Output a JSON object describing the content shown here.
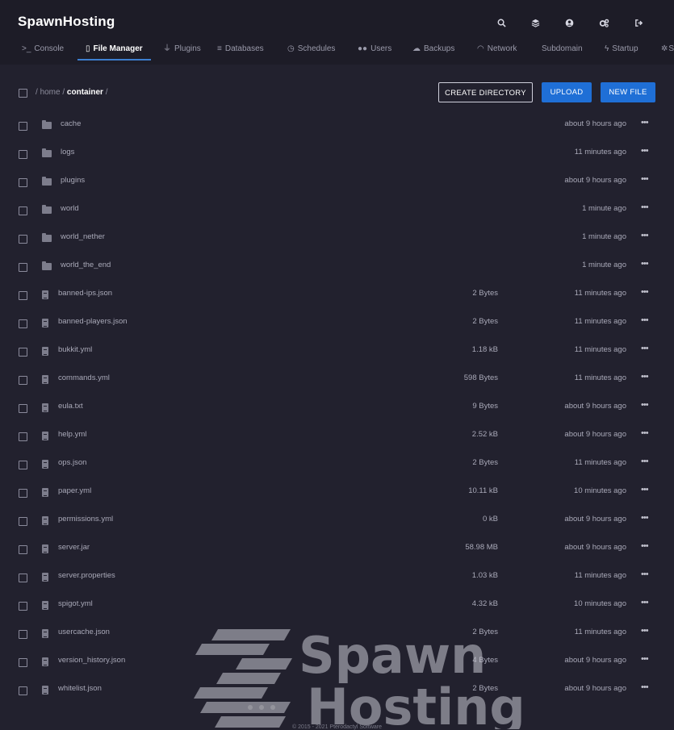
{
  "header": {
    "brand": "SpawnHosting",
    "icons": [
      "search-icon",
      "layers-icon",
      "account-icon",
      "cogs-icon",
      "logout-icon"
    ]
  },
  "tabs": [
    {
      "label": "Console",
      "icon": "terminal-icon",
      "active": false
    },
    {
      "label": "File Manager",
      "icon": "file-icon",
      "active": true
    },
    {
      "label": "Plugins",
      "icon": "plug-icon",
      "active": false
    },
    {
      "label": "Databases",
      "icon": "database-icon",
      "active": false
    },
    {
      "label": "Schedules",
      "icon": "clock-icon",
      "active": false
    },
    {
      "label": "Users",
      "icon": "users-icon",
      "active": false
    },
    {
      "label": "Backups",
      "icon": "cloud-download-icon",
      "active": false
    },
    {
      "label": "Network",
      "icon": "wifi-icon",
      "active": false
    },
    {
      "label": "Subdomain",
      "icon": "",
      "active": false
    },
    {
      "label": "Startup",
      "icon": "bolt-icon",
      "active": false
    },
    {
      "label": "S",
      "icon": "cogs-icon",
      "active": false
    }
  ],
  "breadcrumb": {
    "sep": "/",
    "home": "home",
    "current": "container"
  },
  "buttons": {
    "create_directory": "CREATE DIRECTORY",
    "upload": "UPLOAD",
    "new_file": "NEW FILE"
  },
  "files": [
    {
      "name": "cache",
      "type": "folder",
      "size": "",
      "modified": "about 9 hours ago"
    },
    {
      "name": "logs",
      "type": "folder",
      "size": "",
      "modified": "11 minutes ago"
    },
    {
      "name": "plugins",
      "type": "folder",
      "size": "",
      "modified": "about 9 hours ago"
    },
    {
      "name": "world",
      "type": "folder",
      "size": "",
      "modified": "1 minute ago"
    },
    {
      "name": "world_nether",
      "type": "folder",
      "size": "",
      "modified": "1 minute ago"
    },
    {
      "name": "world_the_end",
      "type": "folder",
      "size": "",
      "modified": "1 minute ago"
    },
    {
      "name": "banned-ips.json",
      "type": "file",
      "size": "2 Bytes",
      "modified": "11 minutes ago"
    },
    {
      "name": "banned-players.json",
      "type": "file",
      "size": "2 Bytes",
      "modified": "11 minutes ago"
    },
    {
      "name": "bukkit.yml",
      "type": "file",
      "size": "1.18 kB",
      "modified": "11 minutes ago"
    },
    {
      "name": "commands.yml",
      "type": "file",
      "size": "598 Bytes",
      "modified": "11 minutes ago"
    },
    {
      "name": "eula.txt",
      "type": "file",
      "size": "9 Bytes",
      "modified": "about 9 hours ago"
    },
    {
      "name": "help.yml",
      "type": "file",
      "size": "2.52 kB",
      "modified": "about 9 hours ago"
    },
    {
      "name": "ops.json",
      "type": "file",
      "size": "2 Bytes",
      "modified": "11 minutes ago"
    },
    {
      "name": "paper.yml",
      "type": "file",
      "size": "10.11 kB",
      "modified": "10 minutes ago"
    },
    {
      "name": "permissions.yml",
      "type": "file",
      "size": "0 kB",
      "modified": "about 9 hours ago"
    },
    {
      "name": "server.jar",
      "type": "file",
      "size": "58.98 MB",
      "modified": "about 9 hours ago"
    },
    {
      "name": "server.properties",
      "type": "file",
      "size": "1.03 kB",
      "modified": "11 minutes ago"
    },
    {
      "name": "spigot.yml",
      "type": "file",
      "size": "4.32 kB",
      "modified": "10 minutes ago"
    },
    {
      "name": "usercache.json",
      "type": "file",
      "size": "2 Bytes",
      "modified": "11 minutes ago"
    },
    {
      "name": "version_history.json",
      "type": "file",
      "size": "4 Bytes",
      "modified": "about 9 hours ago"
    },
    {
      "name": "whitelist.json",
      "type": "file",
      "size": "2 Bytes",
      "modified": "about 9 hours ago"
    }
  ],
  "row_menu_glyph": "•••",
  "watermark": {
    "line1": "Spawn",
    "line2": "Hosting"
  },
  "footer": "© 2015 - 2021 Pterodactyl Software"
}
